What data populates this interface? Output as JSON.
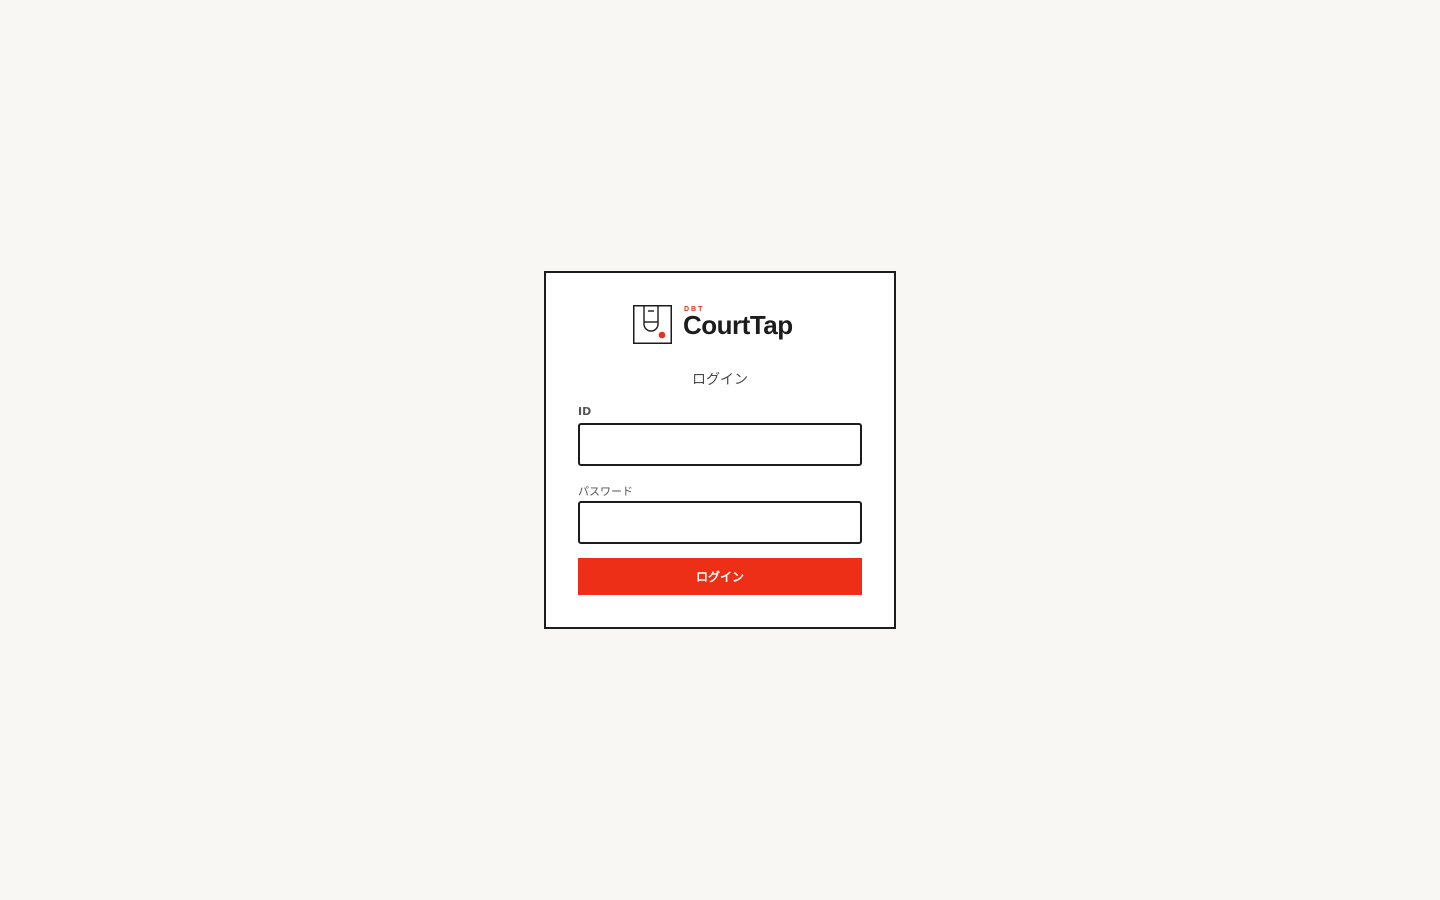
{
  "brand": {
    "sub": "DBT",
    "name": "CourtTap",
    "logo_icon": "court-tap-logo-icon",
    "accent_color": "#ec2f16"
  },
  "login": {
    "title": "ログイン",
    "id_label": "ID",
    "id_value": "",
    "password_label": "パスワード",
    "password_value": "",
    "submit_label": "ログイン"
  }
}
